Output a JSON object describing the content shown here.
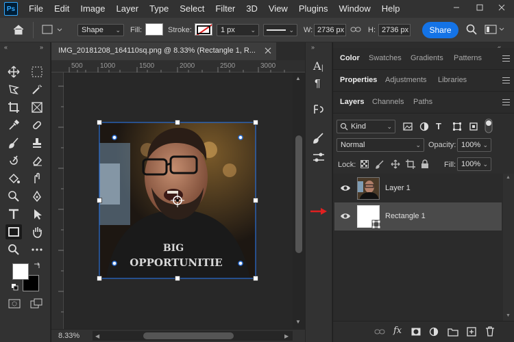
{
  "app": {
    "logo_text": "Ps"
  },
  "menu": [
    "File",
    "Edit",
    "Image",
    "Layer",
    "Type",
    "Select",
    "Filter",
    "3D",
    "View",
    "Plugins",
    "Window",
    "Help"
  ],
  "options_bar": {
    "mode": "Shape",
    "fill_label": "Fill:",
    "stroke_label": "Stroke:",
    "stroke_width": "1 px",
    "w_label": "W:",
    "w_value": "2736 px",
    "h_label": "H:",
    "h_value": "2736 px",
    "share_label": "Share"
  },
  "document": {
    "tab_title": "IMG_20181208_164110sq.png @ 8.33% (Rectangle 1, R...",
    "zoom": "8.33%",
    "ruler_marks": [
      "500",
      "1000",
      "1500",
      "2000",
      "2500",
      "3000"
    ],
    "shirt_text_line1": "BIG",
    "shirt_text_line2": "OPPORTUNITIE"
  },
  "panels": {
    "top_tabs": [
      "Color",
      "Swatches",
      "Gradients",
      "Patterns"
    ],
    "mid_tabs": [
      "Properties",
      "Adjustments",
      "Libraries"
    ],
    "layer_tabs": [
      "Layers",
      "Channels",
      "Paths"
    ],
    "filter_kind": "Kind",
    "blend_mode": "Normal",
    "opacity_label": "Opacity:",
    "opacity_value": "100%",
    "lock_label": "Lock:",
    "fill_label": "Fill:",
    "fill_value": "100%",
    "layers": [
      {
        "name": "Layer 1",
        "selected": false
      },
      {
        "name": "Rectangle 1",
        "selected": true
      }
    ]
  },
  "colors": {
    "accent": "#1473e6",
    "selected_layer": "#4a4a4a",
    "annotation_arrow": "#e02020"
  }
}
